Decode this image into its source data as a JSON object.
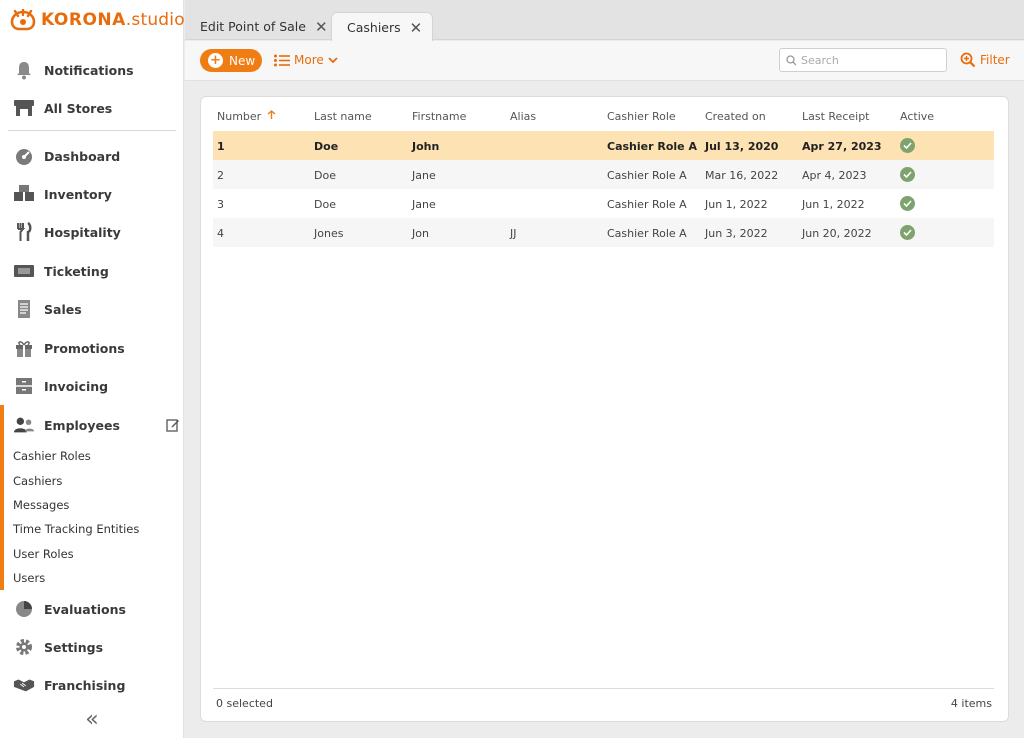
{
  "brand": {
    "name_bold": "KORONA",
    "name_suffix": ".studio",
    "accent": "#f07c14"
  },
  "sidebar": {
    "top_items": [
      {
        "label": "Notifications",
        "icon": "bell-icon"
      },
      {
        "label": "All Stores",
        "icon": "store-icon"
      }
    ],
    "items": [
      {
        "label": "Dashboard",
        "icon": "gauge-icon"
      },
      {
        "label": "Inventory",
        "icon": "boxes-icon"
      },
      {
        "label": "Hospitality",
        "icon": "cutlery-icon"
      },
      {
        "label": "Ticketing",
        "icon": "ticket-icon"
      },
      {
        "label": "Sales",
        "icon": "receipt-icon"
      },
      {
        "label": "Promotions",
        "icon": "gift-icon"
      },
      {
        "label": "Invoicing",
        "icon": "cabinet-icon"
      },
      {
        "label": "Employees",
        "icon": "people-icon"
      }
    ],
    "sub_items": [
      "Cashier Roles",
      "Cashiers",
      "Messages",
      "Time Tracking Entities",
      "User Roles",
      "Users"
    ],
    "bottom_items": [
      {
        "label": "Evaluations",
        "icon": "pie-chart-icon"
      },
      {
        "label": "Settings",
        "icon": "gear-icon"
      },
      {
        "label": "Franchising",
        "icon": "handshake-icon"
      }
    ],
    "collapse_glyph": "«"
  },
  "tabs": [
    {
      "label": "Edit Point of Sale",
      "active": false
    },
    {
      "label": "Cashiers",
      "active": true
    }
  ],
  "toolbar": {
    "new_label": "New",
    "more_label": "More",
    "search_placeholder": "Search",
    "filter_label": "Filter"
  },
  "table": {
    "columns": [
      "Number",
      "Last name",
      "Firstname",
      "Alias",
      "Cashier Role",
      "Created on",
      "Last Receipt",
      "Active"
    ],
    "sort_column": "Number",
    "sort_direction": "ascending",
    "rows": [
      {
        "number": "1",
        "last_name": "Doe",
        "first_name": "John",
        "alias": "",
        "role": "Cashier Role A",
        "created": "Jul 13, 2020",
        "last_receipt": "Apr 27, 2023",
        "active": true,
        "selected": true
      },
      {
        "number": "2",
        "last_name": "Doe",
        "first_name": "Jane",
        "alias": "",
        "role": "Cashier Role A",
        "created": "Mar 16, 2022",
        "last_receipt": "Apr 4, 2023",
        "active": true,
        "selected": false
      },
      {
        "number": "3",
        "last_name": "Doe",
        "first_name": "Jane",
        "alias": "",
        "role": "Cashier Role A",
        "created": "Jun 1, 2022",
        "last_receipt": "Jun 1, 2022",
        "active": true,
        "selected": false
      },
      {
        "number": "4",
        "last_name": "Jones",
        "first_name": "Jon",
        "alias": "JJ",
        "role": "Cashier Role A",
        "created": "Jun 3, 2022",
        "last_receipt": "Jun 20, 2022",
        "active": true,
        "selected": false
      }
    ]
  },
  "footer": {
    "selected_text": "0 selected",
    "count_text": "4 items"
  }
}
